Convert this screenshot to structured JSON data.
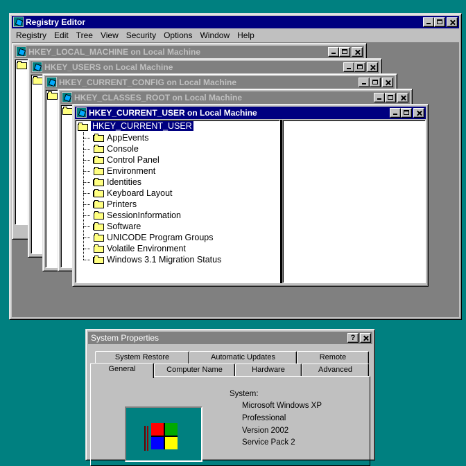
{
  "registry_editor": {
    "title": "Registry Editor",
    "menu": [
      "Registry",
      "Edit",
      "Tree",
      "View",
      "Security",
      "Options",
      "Window",
      "Help"
    ],
    "windows": [
      {
        "title": "HKEY_LOCAL_MACHINE on Local Machine"
      },
      {
        "title": "HKEY_USERS on Local Machine"
      },
      {
        "title": "HKEY_CURRENT_CONFIG on Local Machine"
      },
      {
        "title": "HKEY_CLASSES_ROOT on Local Machine"
      },
      {
        "title": "HKEY_CURRENT_USER on Local Machine"
      }
    ],
    "root_key": "HKEY_CURRENT_USER",
    "tree": [
      {
        "label": "AppEvents",
        "expandable": true
      },
      {
        "label": "Console",
        "expandable": false
      },
      {
        "label": "Control Panel",
        "expandable": true
      },
      {
        "label": "Environment",
        "expandable": false
      },
      {
        "label": "Identities",
        "expandable": true
      },
      {
        "label": "Keyboard Layout",
        "expandable": true
      },
      {
        "label": "Printers",
        "expandable": true
      },
      {
        "label": "SessionInformation",
        "expandable": false
      },
      {
        "label": "Software",
        "expandable": true
      },
      {
        "label": "UNICODE Program Groups",
        "expandable": false
      },
      {
        "label": "Volatile Environment",
        "expandable": false
      },
      {
        "label": "Windows 3.1 Migration Status",
        "expandable": true
      }
    ]
  },
  "system_properties": {
    "title": "System Properties",
    "help_btn": "?",
    "tabs_back": [
      "System Restore",
      "Automatic Updates",
      "Remote"
    ],
    "tabs_front": [
      "General",
      "Computer Name",
      "Hardware",
      "Advanced"
    ],
    "system_label": "System:",
    "system_lines": [
      "Microsoft Windows XP",
      "Professional",
      "Version 2002",
      "Service Pack 2"
    ]
  },
  "colors": {
    "desktop": "#008080",
    "active_title": "#000080",
    "inactive_title": "#808080",
    "selection": "#000080"
  }
}
